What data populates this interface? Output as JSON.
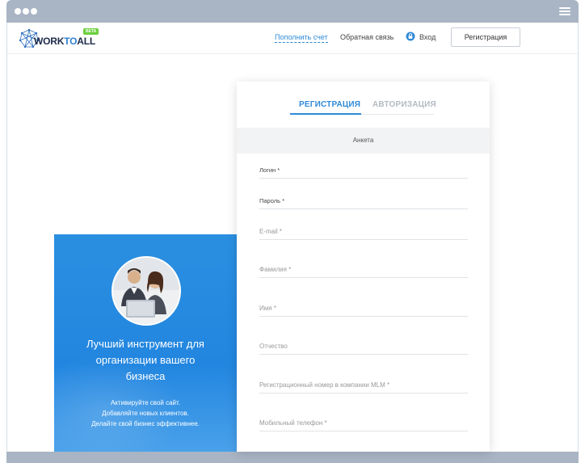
{
  "header": {
    "logo_prefix": "WORK",
    "logo_to": "TO",
    "logo_suffix": "ALL",
    "beta": "BETA",
    "top_up": "Пополнить счет",
    "feedback": "Обратная связь",
    "login": "Вход",
    "register_button": "Регистрация"
  },
  "promo": {
    "title": "Лучший инструмент для организации вашего бизнеса",
    "line1": "Активируйте свой сайт.",
    "line2": "Добавляйте новых клиентов.",
    "line3": "Делайте свой бизнес эффективнее."
  },
  "form": {
    "tab_register": "РЕГИСТРАЦИЯ",
    "tab_login": "АВТОРИЗАЦИЯ",
    "section": "Анкета",
    "fields": [
      {
        "label": "Логин *"
      },
      {
        "label": "Пароль *"
      },
      {
        "label": "E-mail *"
      },
      {
        "label": "Фамилия *"
      },
      {
        "label": "Имя *"
      },
      {
        "label": "Отчество"
      },
      {
        "label": "Регистрационный номер в компании MLM *"
      },
      {
        "label": "Мобильный телефон *"
      }
    ]
  },
  "colors": {
    "accent": "#2f8ad8",
    "frame": "#a9b5c4",
    "beta": "#6ccf3e"
  }
}
